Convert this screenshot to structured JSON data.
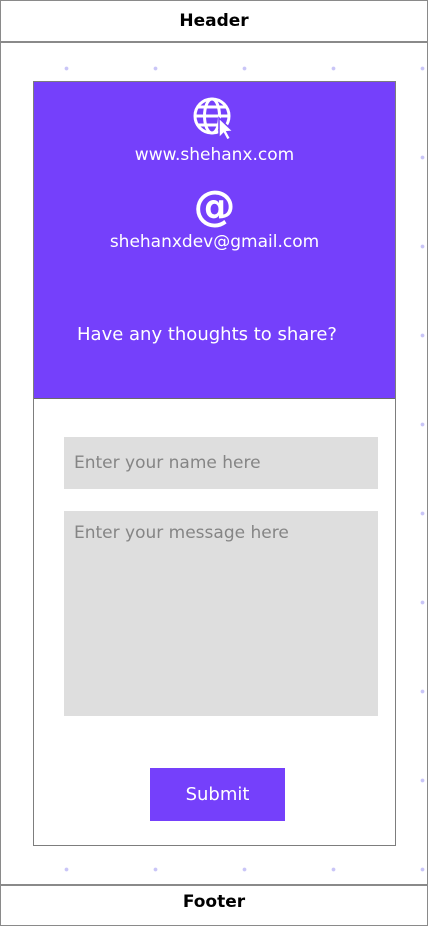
{
  "header": {
    "title": "Header"
  },
  "footer": {
    "title": "Footer"
  },
  "contact": {
    "website": "www.shehanx.com",
    "at_symbol": "@",
    "email": "shehanxdev@gmail.com",
    "prompt": "Have any thoughts to share?"
  },
  "form": {
    "name_placeholder": "Enter your name here",
    "name_value": "",
    "message_placeholder": "Enter your message here",
    "message_value": "",
    "submit_label": "Submit"
  },
  "icons": {
    "website": "globe-cursor-icon",
    "email": "at-icon"
  },
  "colors": {
    "accent": "#7540fb",
    "input_background": "#dedede",
    "border": "#8a8a8a"
  }
}
